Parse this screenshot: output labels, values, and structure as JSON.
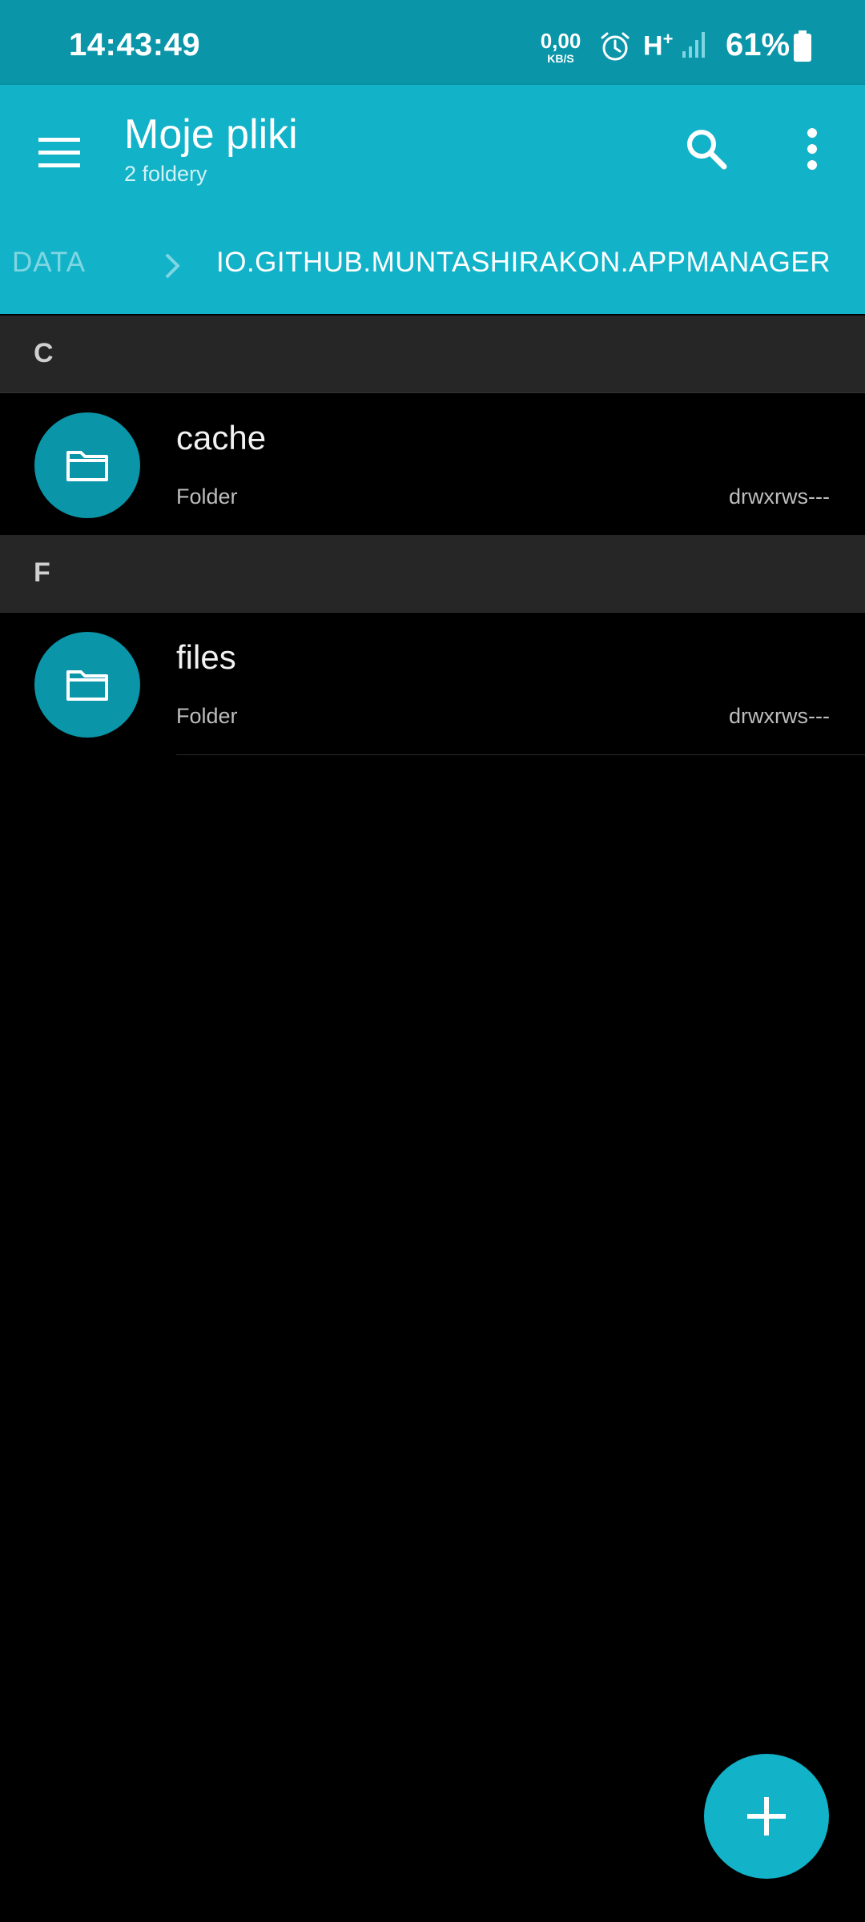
{
  "status_bar": {
    "time": "14:43:49",
    "net_speed_value": "0,00",
    "net_speed_unit": "KB/S",
    "network_type": "H",
    "network_type_sup": "+",
    "battery": "61%"
  },
  "app_bar": {
    "title": "Moje pliki",
    "subtitle": "2 foldery"
  },
  "breadcrumb": {
    "items": [
      "DATA",
      "IO.GITHUB.MUNTASHIRAKON.APPMANAGER"
    ]
  },
  "sections": [
    {
      "letter": "C",
      "items": [
        {
          "name": "cache",
          "type": "Folder",
          "permissions": "drwxrws---"
        }
      ]
    },
    {
      "letter": "F",
      "items": [
        {
          "name": "files",
          "type": "Folder",
          "permissions": "drwxrws---"
        }
      ]
    }
  ],
  "colors": {
    "primary": "#12b2c8",
    "primary_dark": "#0a95a8",
    "background": "#000000",
    "section_header": "#262626"
  },
  "icons": {
    "menu": "hamburger-menu-icon",
    "search": "search-icon",
    "more": "more-vertical-icon",
    "folder": "folder-icon",
    "fab": "plus-icon"
  }
}
